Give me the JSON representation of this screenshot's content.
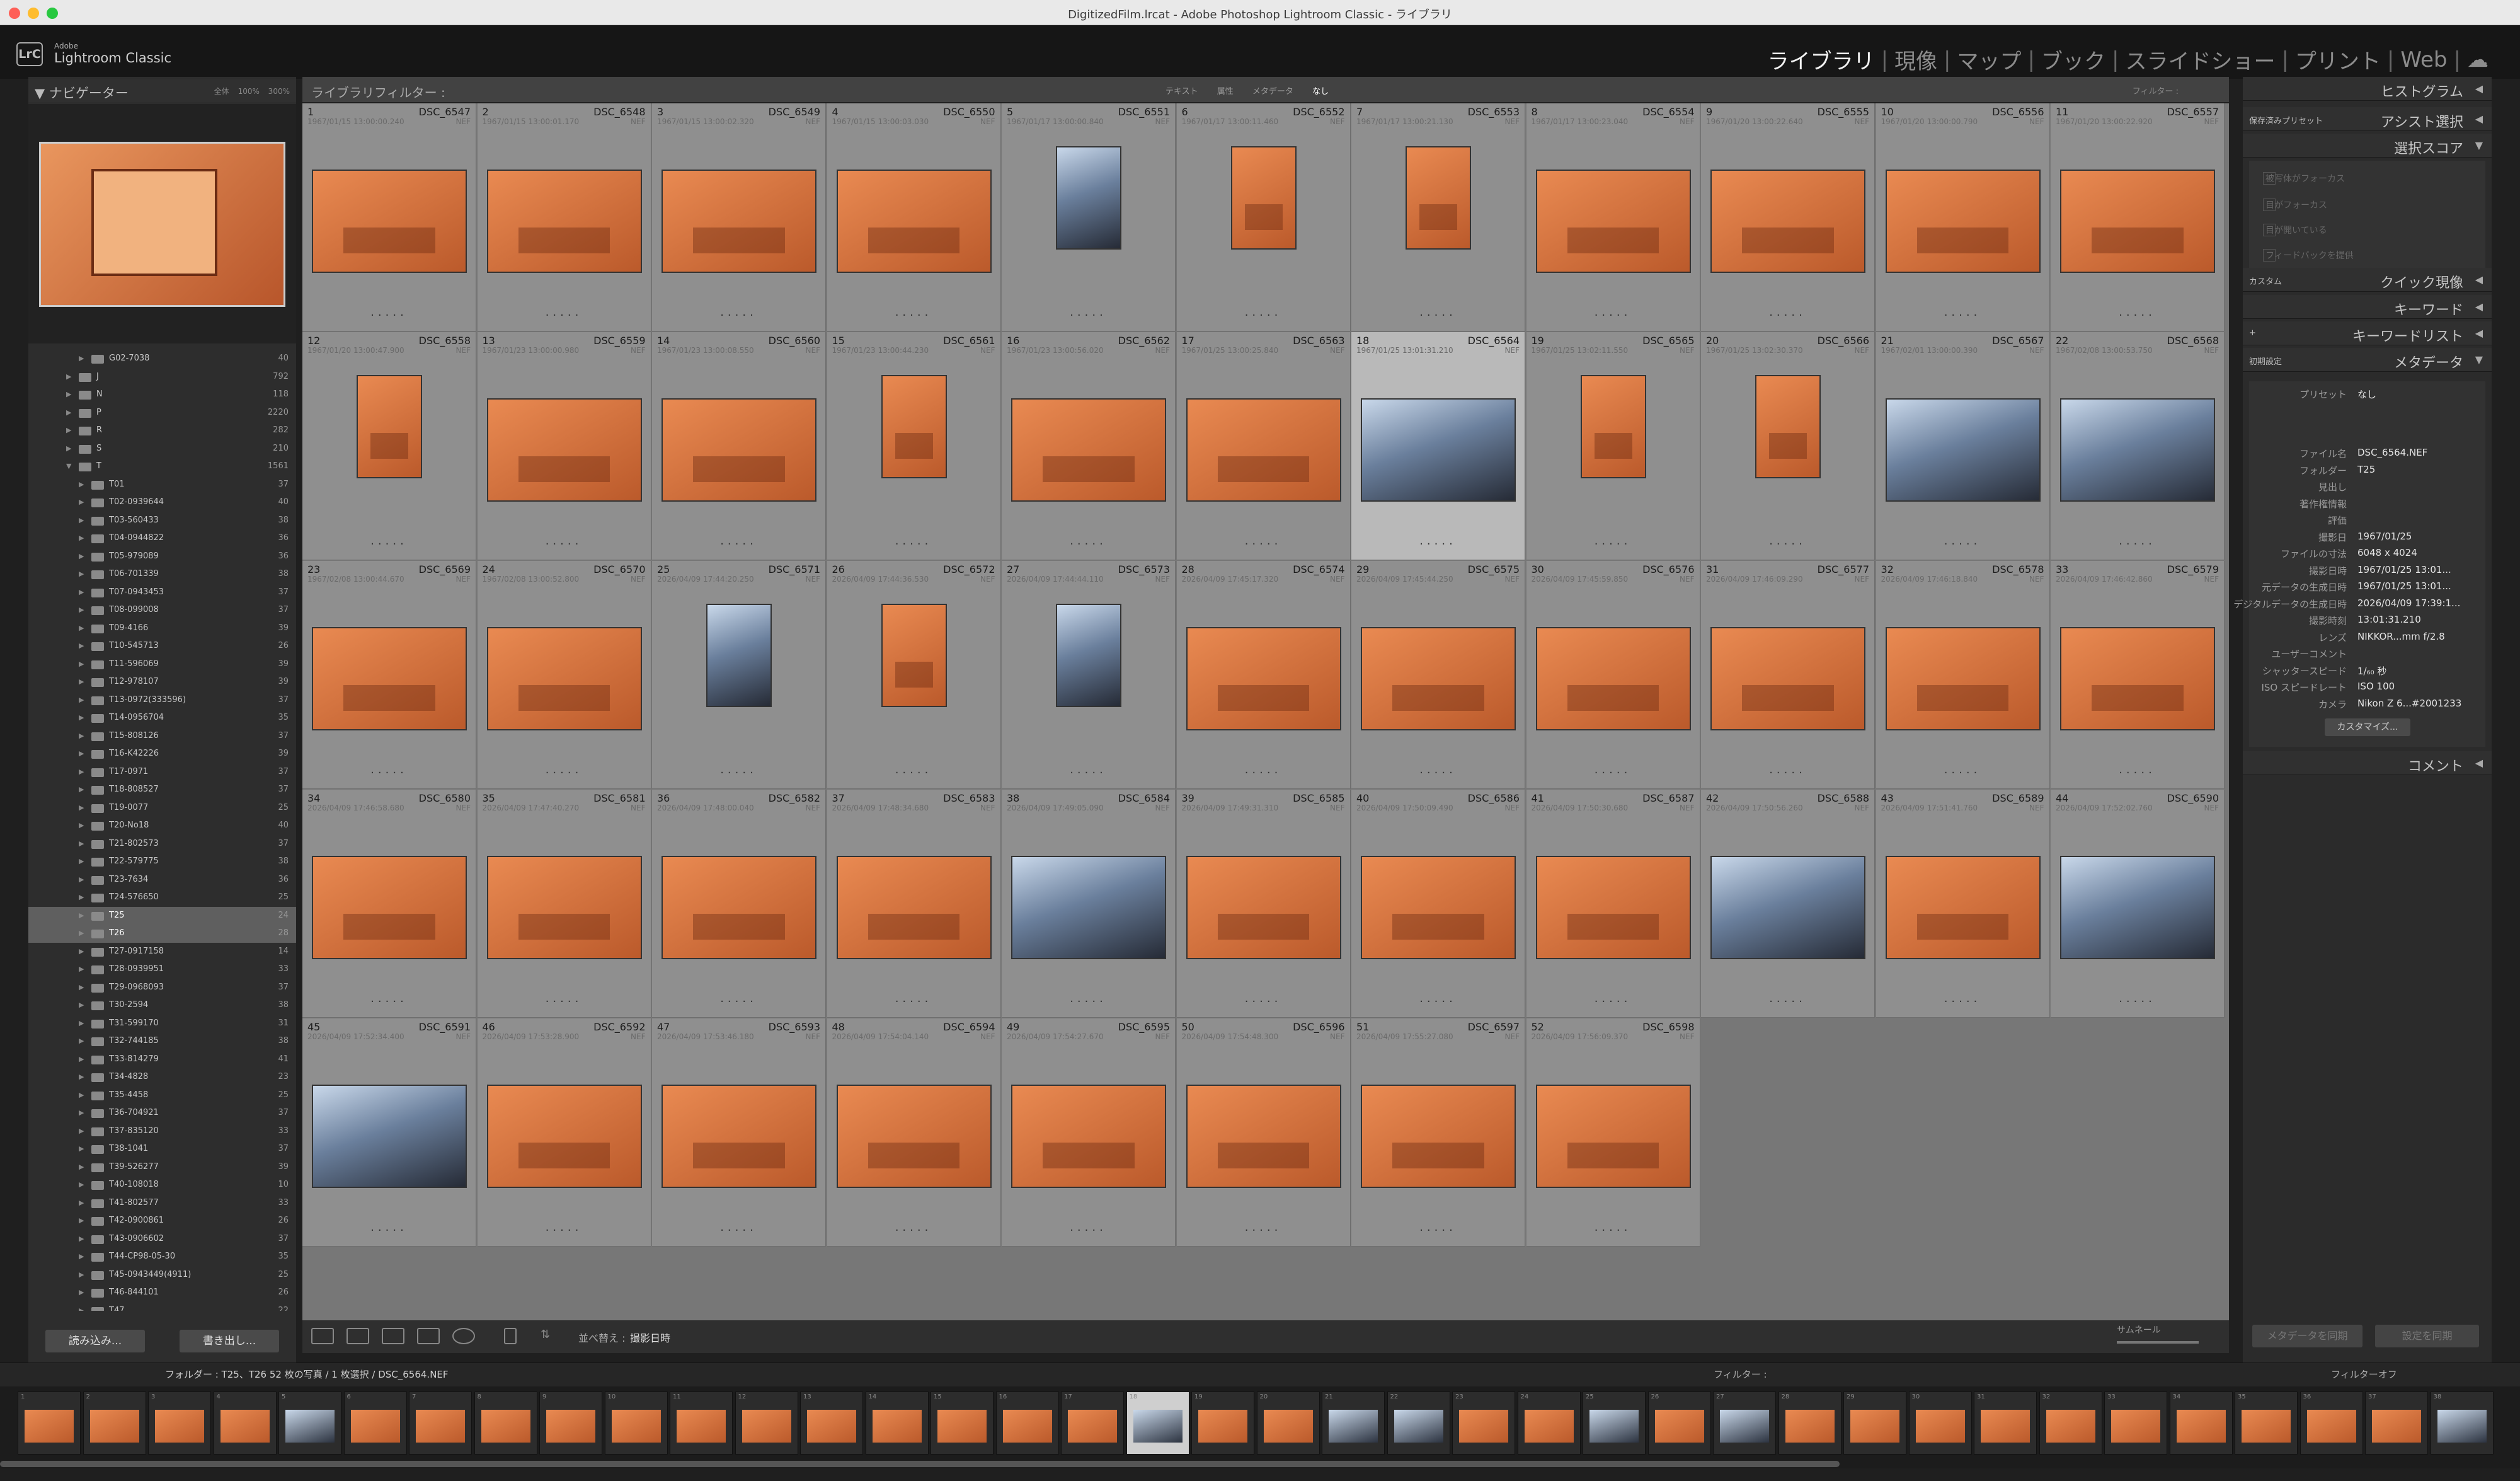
{
  "window_title": "DigitizedFilm.lrcat - Adobe Photoshop Lightroom Classic - ライブラリ",
  "app": {
    "adobe": "Adobe",
    "name": "Lightroom Classic",
    "logo": "LrC"
  },
  "modules": [
    "ライブラリ",
    "現像",
    "マップ",
    "ブック",
    "スライドショー",
    "プリント",
    "Web"
  ],
  "navigator": {
    "title": "ナビゲーター",
    "options": "全体  100%  300%"
  },
  "folders": [
    {
      "name": "G02-7038",
      "count": "40",
      "level": 2
    },
    {
      "name": "J",
      "count": "792",
      "level": 1
    },
    {
      "name": "N",
      "count": "118",
      "level": 1
    },
    {
      "name": "P",
      "count": "2220",
      "level": 1
    },
    {
      "name": "R",
      "count": "282",
      "level": 1
    },
    {
      "name": "S",
      "count": "210",
      "level": 1
    },
    {
      "name": "T",
      "count": "1561",
      "level": 1,
      "open": true
    },
    {
      "name": "T01",
      "count": "37",
      "level": 2
    },
    {
      "name": "T02-0939644",
      "count": "40",
      "level": 2
    },
    {
      "name": "T03-560433",
      "count": "38",
      "level": 2
    },
    {
      "name": "T04-0944822",
      "count": "36",
      "level": 2
    },
    {
      "name": "T05-979089",
      "count": "36",
      "level": 2
    },
    {
      "name": "T06-701339",
      "count": "38",
      "level": 2
    },
    {
      "name": "T07-0943453",
      "count": "37",
      "level": 2
    },
    {
      "name": "T08-099008",
      "count": "37",
      "level": 2
    },
    {
      "name": "T09-4166",
      "count": "39",
      "level": 2
    },
    {
      "name": "T10-545713",
      "count": "26",
      "level": 2
    },
    {
      "name": "T11-596069",
      "count": "39",
      "level": 2
    },
    {
      "name": "T12-978107",
      "count": "39",
      "level": 2
    },
    {
      "name": "T13-0972(333596)",
      "count": "37",
      "level": 2
    },
    {
      "name": "T14-0956704",
      "count": "35",
      "level": 2
    },
    {
      "name": "T15-808126",
      "count": "37",
      "level": 2
    },
    {
      "name": "T16-K42226",
      "count": "39",
      "level": 2
    },
    {
      "name": "T17-0971",
      "count": "37",
      "level": 2
    },
    {
      "name": "T18-808527",
      "count": "37",
      "level": 2
    },
    {
      "name": "T19-0077",
      "count": "25",
      "level": 2
    },
    {
      "name": "T20-No18",
      "count": "40",
      "level": 2
    },
    {
      "name": "T21-802573",
      "count": "37",
      "level": 2
    },
    {
      "name": "T22-579775",
      "count": "38",
      "level": 2
    },
    {
      "name": "T23-7634",
      "count": "36",
      "level": 2
    },
    {
      "name": "T24-576650",
      "count": "25",
      "level": 2
    },
    {
      "name": "T25",
      "count": "24",
      "level": 2,
      "selected": true
    },
    {
      "name": "T26",
      "count": "28",
      "level": 2,
      "selected": true
    },
    {
      "name": "T27-0917158",
      "count": "14",
      "level": 2
    },
    {
      "name": "T28-0939951",
      "count": "33",
      "level": 2
    },
    {
      "name": "T29-0968093",
      "count": "37",
      "level": 2
    },
    {
      "name": "T30-2594",
      "count": "38",
      "level": 2
    },
    {
      "name": "T31-599170",
      "count": "31",
      "level": 2
    },
    {
      "name": "T32-744185",
      "count": "38",
      "level": 2
    },
    {
      "name": "T33-814279",
      "count": "41",
      "level": 2
    },
    {
      "name": "T34-4828",
      "count": "23",
      "level": 2
    },
    {
      "name": "T35-4458",
      "count": "25",
      "level": 2
    },
    {
      "name": "T36-704921",
      "count": "37",
      "level": 2
    },
    {
      "name": "T37-835120",
      "count": "33",
      "level": 2
    },
    {
      "name": "T38-1041",
      "count": "37",
      "level": 2
    },
    {
      "name": "T39-526277",
      "count": "39",
      "level": 2
    },
    {
      "name": "T40-108018",
      "count": "10",
      "level": 2
    },
    {
      "name": "T41-802577",
      "count": "33",
      "level": 2
    },
    {
      "name": "T42-0900861",
      "count": "26",
      "level": 2
    },
    {
      "name": "T43-0906602",
      "count": "37",
      "level": 2
    },
    {
      "name": "T44-CP98-05-30",
      "count": "35",
      "level": 2
    },
    {
      "name": "T45-0943449(4911)",
      "count": "25",
      "level": 2
    },
    {
      "name": "T46-844101",
      "count": "26",
      "level": 2
    },
    {
      "name": "T47",
      "count": "22",
      "level": 2
    }
  ],
  "buttons": {
    "import": "読み込み...",
    "export": "書き出し..."
  },
  "filter_bar": {
    "title": "ライブラリフィルター :",
    "options": [
      "テキスト",
      "属性",
      "メタデータ",
      "なし"
    ],
    "active": "なし",
    "preset": "フィルター :"
  },
  "grid": {
    "selected_index": 18,
    "photos": [
      {
        "n": "1",
        "file": "DSC_6547",
        "date": "1967/01/15 13:00:00.240",
        "ext": "NEF",
        "o": "h"
      },
      {
        "n": "2",
        "file": "DSC_6548",
        "date": "1967/01/15 13:00:01.170",
        "ext": "NEF",
        "o": "h"
      },
      {
        "n": "3",
        "file": "DSC_6549",
        "date": "1967/01/15 13:00:02.320",
        "ext": "NEF",
        "o": "h"
      },
      {
        "n": "4",
        "file": "DSC_6550",
        "date": "1967/01/15 13:00:03.030",
        "ext": "NEF",
        "o": "h"
      },
      {
        "n": "5",
        "file": "DSC_6551",
        "date": "1967/01/17 13:00:00.840",
        "ext": "NEF",
        "o": "v",
        "c": true
      },
      {
        "n": "6",
        "file": "DSC_6552",
        "date": "1967/01/17 13:00:11.460",
        "ext": "NEF",
        "o": "v"
      },
      {
        "n": "7",
        "file": "DSC_6553",
        "date": "1967/01/17 13:00:21.130",
        "ext": "NEF",
        "o": "v"
      },
      {
        "n": "8",
        "file": "DSC_6554",
        "date": "1967/01/17 13:00:23.040",
        "ext": "NEF",
        "o": "h"
      },
      {
        "n": "9",
        "file": "DSC_6555",
        "date": "1967/01/20 13:00:22.640",
        "ext": "NEF",
        "o": "h"
      },
      {
        "n": "10",
        "file": "DSC_6556",
        "date": "1967/01/20 13:00:00.790",
        "ext": "NEF",
        "o": "h"
      },
      {
        "n": "11",
        "file": "DSC_6557",
        "date": "1967/01/20 13:00:22.920",
        "ext": "NEF",
        "o": "h"
      },
      {
        "n": "12",
        "file": "DSC_6558",
        "date": "1967/01/20 13:00:47.900",
        "ext": "NEF",
        "o": "v"
      },
      {
        "n": "13",
        "file": "DSC_6559",
        "date": "1967/01/23 13:00:00.980",
        "ext": "NEF",
        "o": "h"
      },
      {
        "n": "14",
        "file": "DSC_6560",
        "date": "1967/01/23 13:00:08.550",
        "ext": "NEF",
        "o": "h"
      },
      {
        "n": "15",
        "file": "DSC_6561",
        "date": "1967/01/23 13:00:44.230",
        "ext": "NEF",
        "o": "v"
      },
      {
        "n": "16",
        "file": "DSC_6562",
        "date": "1967/01/23 13:00:56.020",
        "ext": "NEF",
        "o": "h"
      },
      {
        "n": "17",
        "file": "DSC_6563",
        "date": "1967/01/25 13:00:25.840",
        "ext": "NEF",
        "o": "h"
      },
      {
        "n": "18",
        "file": "DSC_6564",
        "date": "1967/01/25 13:01:31.210",
        "ext": "NEF",
        "o": "h",
        "c": true
      },
      {
        "n": "19",
        "file": "DSC_6565",
        "date": "1967/01/25 13:02:11.550",
        "ext": "NEF",
        "o": "v"
      },
      {
        "n": "20",
        "file": "DSC_6566",
        "date": "1967/01/25 13:02:30.370",
        "ext": "NEF",
        "o": "v"
      },
      {
        "n": "21",
        "file": "DSC_6567",
        "date": "1967/02/01 13:00:00.390",
        "ext": "NEF",
        "o": "h",
        "c": true
      },
      {
        "n": "22",
        "file": "DSC_6568",
        "date": "1967/02/08 13:00:53.750",
        "ext": "NEF",
        "o": "h",
        "c": true
      },
      {
        "n": "23",
        "file": "DSC_6569",
        "date": "1967/02/08 13:00:44.670",
        "ext": "NEF",
        "o": "h"
      },
      {
        "n": "24",
        "file": "DSC_6570",
        "date": "1967/02/08 13:00:52.800",
        "ext": "NEF",
        "o": "h"
      },
      {
        "n": "25",
        "file": "DSC_6571",
        "date": "2026/04/09 17:44:20.250",
        "ext": "NEF",
        "o": "v",
        "c": true
      },
      {
        "n": "26",
        "file": "DSC_6572",
        "date": "2026/04/09 17:44:36.530",
        "ext": "NEF",
        "o": "v"
      },
      {
        "n": "27",
        "file": "DSC_6573",
        "date": "2026/04/09 17:44:44.110",
        "ext": "NEF",
        "o": "v",
        "c": true
      },
      {
        "n": "28",
        "file": "DSC_6574",
        "date": "2026/04/09 17:45:17.320",
        "ext": "NEF",
        "o": "h"
      },
      {
        "n": "29",
        "file": "DSC_6575",
        "date": "2026/04/09 17:45:44.250",
        "ext": "NEF",
        "o": "h"
      },
      {
        "n": "30",
        "file": "DSC_6576",
        "date": "2026/04/09 17:45:59.850",
        "ext": "NEF",
        "o": "h"
      },
      {
        "n": "31",
        "file": "DSC_6577",
        "date": "2026/04/09 17:46:09.290",
        "ext": "NEF",
        "o": "h"
      },
      {
        "n": "32",
        "file": "DSC_6578",
        "date": "2026/04/09 17:46:18.840",
        "ext": "NEF",
        "o": "h"
      },
      {
        "n": "33",
        "file": "DSC_6579",
        "date": "2026/04/09 17:46:42.860",
        "ext": "NEF",
        "o": "h"
      },
      {
        "n": "34",
        "file": "DSC_6580",
        "date": "2026/04/09 17:46:58.680",
        "ext": "NEF",
        "o": "h"
      },
      {
        "n": "35",
        "file": "DSC_6581",
        "date": "2026/04/09 17:47:40.270",
        "ext": "NEF",
        "o": "h"
      },
      {
        "n": "36",
        "file": "DSC_6582",
        "date": "2026/04/09 17:48:00.040",
        "ext": "NEF",
        "o": "h"
      },
      {
        "n": "37",
        "file": "DSC_6583",
        "date": "2026/04/09 17:48:34.680",
        "ext": "NEF",
        "o": "h"
      },
      {
        "n": "38",
        "file": "DSC_6584",
        "date": "2026/04/09 17:49:05.090",
        "ext": "NEF",
        "o": "h",
        "c": true
      },
      {
        "n": "39",
        "file": "DSC_6585",
        "date": "2026/04/09 17:49:31.310",
        "ext": "NEF",
        "o": "h"
      },
      {
        "n": "40",
        "file": "DSC_6586",
        "date": "2026/04/09 17:50:09.490",
        "ext": "NEF",
        "o": "h"
      },
      {
        "n": "41",
        "file": "DSC_6587",
        "date": "2026/04/09 17:50:30.680",
        "ext": "NEF",
        "o": "h"
      },
      {
        "n": "42",
        "file": "DSC_6588",
        "date": "2026/04/09 17:50:56.260",
        "ext": "NEF",
        "o": "h",
        "c": true
      },
      {
        "n": "43",
        "file": "DSC_6589",
        "date": "2026/04/09 17:51:41.760",
        "ext": "NEF",
        "o": "h"
      },
      {
        "n": "44",
        "file": "DSC_6590",
        "date": "2026/04/09 17:52:02.760",
        "ext": "NEF",
        "o": "h",
        "c": true
      },
      {
        "n": "45",
        "file": "DSC_6591",
        "date": "2026/04/09 17:52:34.400",
        "ext": "NEF",
        "o": "h",
        "c": true
      },
      {
        "n": "46",
        "file": "DSC_6592",
        "date": "2026/04/09 17:53:28.900",
        "ext": "NEF",
        "o": "h"
      },
      {
        "n": "47",
        "file": "DSC_6593",
        "date": "2026/04/09 17:53:46.180",
        "ext": "NEF",
        "o": "h"
      },
      {
        "n": "48",
        "file": "DSC_6594",
        "date": "2026/04/09 17:54:04.140",
        "ext": "NEF",
        "o": "h"
      },
      {
        "n": "49",
        "file": "DSC_6595",
        "date": "2026/04/09 17:54:27.670",
        "ext": "NEF",
        "o": "h"
      },
      {
        "n": "50",
        "file": "DSC_6596",
        "date": "2026/04/09 17:54:48.300",
        "ext": "NEF",
        "o": "h"
      },
      {
        "n": "51",
        "file": "DSC_6597",
        "date": "2026/04/09 17:55:27.080",
        "ext": "NEF",
        "o": "h"
      },
      {
        "n": "52",
        "file": "DSC_6598",
        "date": "2026/04/09 17:56:09.370",
        "ext": "NEF",
        "o": "h"
      }
    ]
  },
  "toolbar": {
    "sort_label": "並べ替え :",
    "sort_value": "撮影日時",
    "thumb_label": "サムネール"
  },
  "right_panel": {
    "histogram": "ヒストグラム",
    "quick_dev": "アシスト選択",
    "quick_dev_preset": "保存済みプリセット",
    "score": "選択スコア",
    "score_items": [
      "被写体がフォーカス",
      "目がフォーカス",
      "目が開いている",
      "フィードバックを提供"
    ],
    "quick_develop": "クイック現像",
    "quick_develop_preset": "カスタム",
    "keywords": "キーワード",
    "keyword_list": "キーワードリスト",
    "metadata": "メタデータ",
    "metadata_preset": "初期設定",
    "preset_label": "プリセット",
    "preset_value": "なし",
    "comment": "コメント",
    "customize": "カスタマイズ...",
    "btn_sync_meta": "メタデータを同期",
    "btn_sync_settings": "設定を同期"
  },
  "metadata": [
    {
      "k": "ファイル名",
      "v": "DSC_6564.NEF"
    },
    {
      "k": "フォルダー",
      "v": "T25"
    },
    {
      "k": "見出し",
      "v": ""
    },
    {
      "k": "著作権情報",
      "v": ""
    },
    {
      "k": "評価",
      "v": ""
    },
    {
      "k": "撮影日",
      "v": "1967/01/25"
    },
    {
      "k": "ファイルの寸法",
      "v": "6048 x 4024"
    },
    {
      "k": "撮影日時",
      "v": "1967/01/25 13:01..."
    },
    {
      "k": "元データの生成日時",
      "v": "1967/01/25 13:01..."
    },
    {
      "k": "デジタルデータの生成日時",
      "v": "2026/04/09 17:39:1..."
    },
    {
      "k": "撮影時刻",
      "v": "13:01:31.210"
    },
    {
      "k": "レンズ",
      "v": "NIKKOR...mm f/2.8"
    },
    {
      "k": "ユーザーコメント",
      "v": ""
    },
    {
      "k": "シャッタースピード",
      "v": "1/₆₀ 秒"
    },
    {
      "k": "ISO スピードレート",
      "v": "ISO 100"
    },
    {
      "k": "カメラ",
      "v": "Nikon Z 6...#2001233"
    }
  ],
  "filmstrip": {
    "info": "フォルダー : T25、T26   52 枚の写真 / 1 枚選択 / DSC_6564.NEF",
    "filter_label": "フィルター :",
    "filter_off": "フィルターオフ"
  }
}
